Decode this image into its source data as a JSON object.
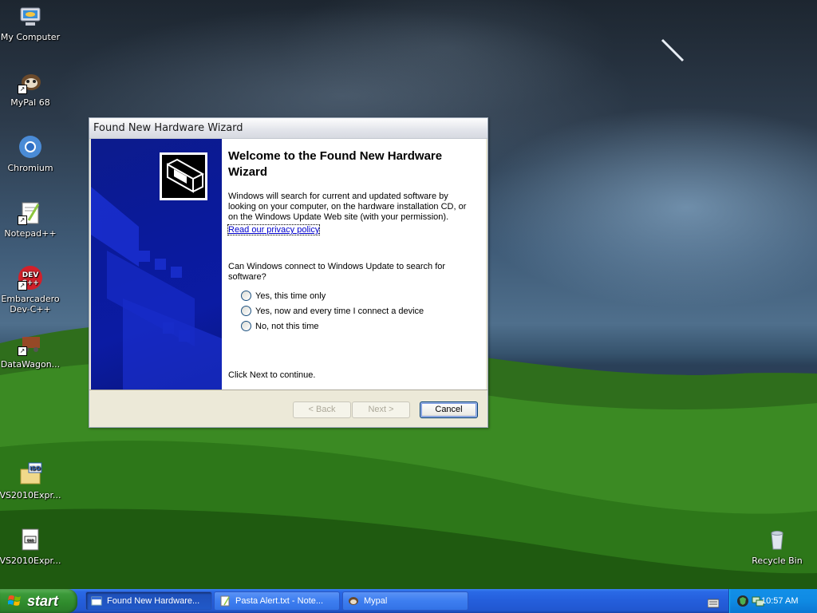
{
  "desktop": {
    "icons": [
      {
        "label": "My Computer"
      },
      {
        "label": "MyPal 68"
      },
      {
        "label": "Chromium"
      },
      {
        "label": "Notepad++"
      },
      {
        "label": "Embarcadero Dev-C++"
      },
      {
        "label": "DataWagon..."
      },
      {
        "label": "VS2010Expr..."
      },
      {
        "label": "VS2010Expr..."
      },
      {
        "label": "Recycle Bin"
      }
    ]
  },
  "wizard": {
    "title": "Found New Hardware Wizard",
    "heading": "Welcome to the Found New Hardware Wizard",
    "intro": "Windows will search for current and updated software by looking on your computer, on the hardware installation CD, or on the Windows Update Web site (with your permission).",
    "privacy_link": "Read our privacy policy",
    "question": "Can Windows connect to Windows Update to search for software?",
    "options": [
      {
        "label": "Yes, this time only",
        "selected": false
      },
      {
        "label": "Yes, now and every time I connect a device",
        "selected": false
      },
      {
        "label": "No, not this time",
        "selected": false
      }
    ],
    "continue_text": "Click Next to continue.",
    "buttons": {
      "back": "< Back",
      "next": "Next >",
      "cancel": "Cancel"
    }
  },
  "taskbar": {
    "start_label": "start",
    "tasks": [
      {
        "label": "Found New Hardware...",
        "active": true
      },
      {
        "label": "Pasta Alert.txt - Note...",
        "active": false
      },
      {
        "label": "Mypal",
        "active": false
      }
    ],
    "clock": "10:57 AM"
  },
  "colors": {
    "taskbar_blue": "#245edb",
    "start_green": "#3c9a3a",
    "wizard_side_blue": "#0a1a9b",
    "window_face": "#ece9d8"
  }
}
